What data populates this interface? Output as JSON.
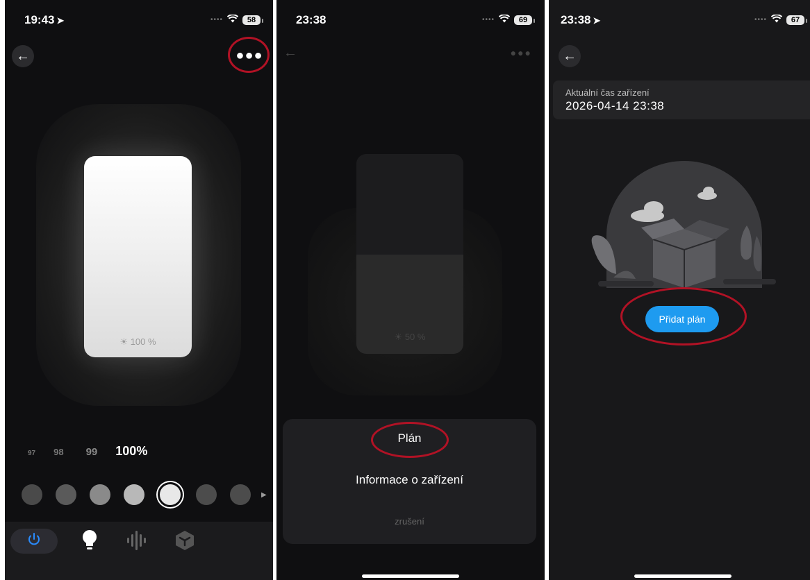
{
  "panels": {
    "brightness": {
      "status": {
        "time": "19:43",
        "battery": "58"
      },
      "brightness_label": "100 %",
      "scale": [
        "97",
        "98",
        "99",
        "100%"
      ],
      "swatch_colors": [
        "#4a4a4a",
        "#5a5a5a",
        "#8a8a8a",
        "#b8b8b8",
        "#e8e8e8",
        "#4c4c4c",
        "#4c4c4c"
      ],
      "selected_swatch": 4
    },
    "menu": {
      "status": {
        "time": "23:38",
        "battery": "69"
      },
      "brightness_label": "50 %",
      "sheet": {
        "option_plan": "Plán",
        "option_info": "Informace o zařízení",
        "cancel": "zrušení"
      }
    },
    "schedule": {
      "status": {
        "time": "23:38",
        "battery": "67"
      },
      "time_card": {
        "label": "Aktuální čas zařízení",
        "value": "2026-04-14 23:38"
      },
      "add_button": "Přidat plán"
    }
  },
  "icons": {
    "back": "arrow-left-icon",
    "more": "ellipsis-icon",
    "power": "power-icon",
    "bulb": "light-bulb-icon",
    "music": "sound-wave-icon",
    "scene": "cube-icon"
  },
  "colors": {
    "accent_blue": "#1e9bf0",
    "highlight_red": "#b11225",
    "bg_dark": "#0f0f11"
  }
}
